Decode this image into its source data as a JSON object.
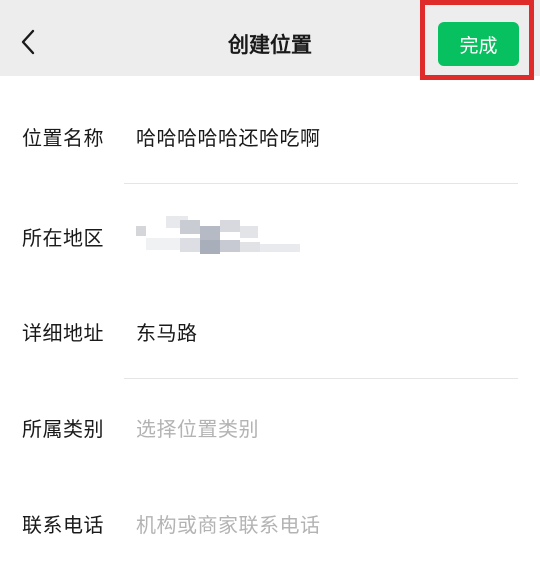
{
  "header": {
    "title": "创建位置",
    "back_icon": "chevron-left-icon",
    "done_label": "完成",
    "done_color": "#07c160",
    "highlight_color": "#e02b2b"
  },
  "form": {
    "name": {
      "label": "位置名称",
      "value": "哈哈哈哈哈还哈吃啊"
    },
    "region": {
      "label": "所在地区",
      "value": "",
      "redacted": true
    },
    "address": {
      "label": "详细地址",
      "value": "东马路"
    },
    "category": {
      "label": "所属类别",
      "placeholder": "选择位置类别"
    },
    "phone": {
      "label": "联系电话",
      "placeholder": "机构或商家联系电话"
    }
  }
}
